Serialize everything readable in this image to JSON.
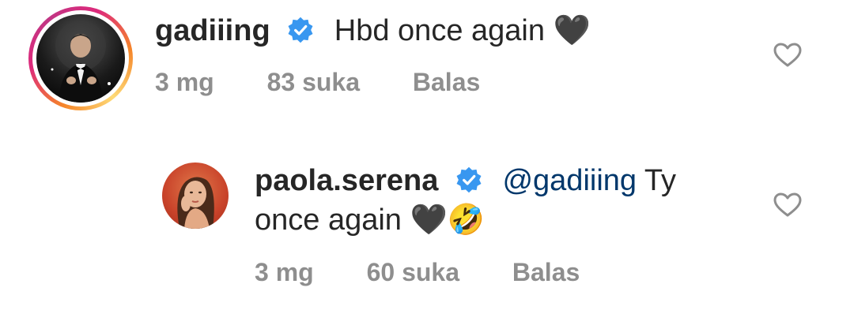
{
  "comments": [
    {
      "username": "gadiiing",
      "verified": true,
      "text": "Hbd once again",
      "emoji": "🖤",
      "time": "3 mg",
      "likes": "83 suka",
      "reply_label": "Balas",
      "avatar_icon": "man-in-tuxedo-avatar",
      "has_story_ring": true
    },
    {
      "username": "paola.serena",
      "verified": true,
      "mention": "@gadiiing",
      "text_after_mention": " Ty",
      "text_line2": "once again ",
      "emoji": "🖤🤣",
      "time": "3 mg",
      "likes": "60 suka",
      "reply_label": "Balas",
      "avatar_icon": "woman-avatar",
      "has_story_ring": false
    }
  ],
  "colors": {
    "text": "#262626",
    "meta": "#8e8e8e",
    "mention": "#00376b",
    "verified": "#3897f0"
  }
}
